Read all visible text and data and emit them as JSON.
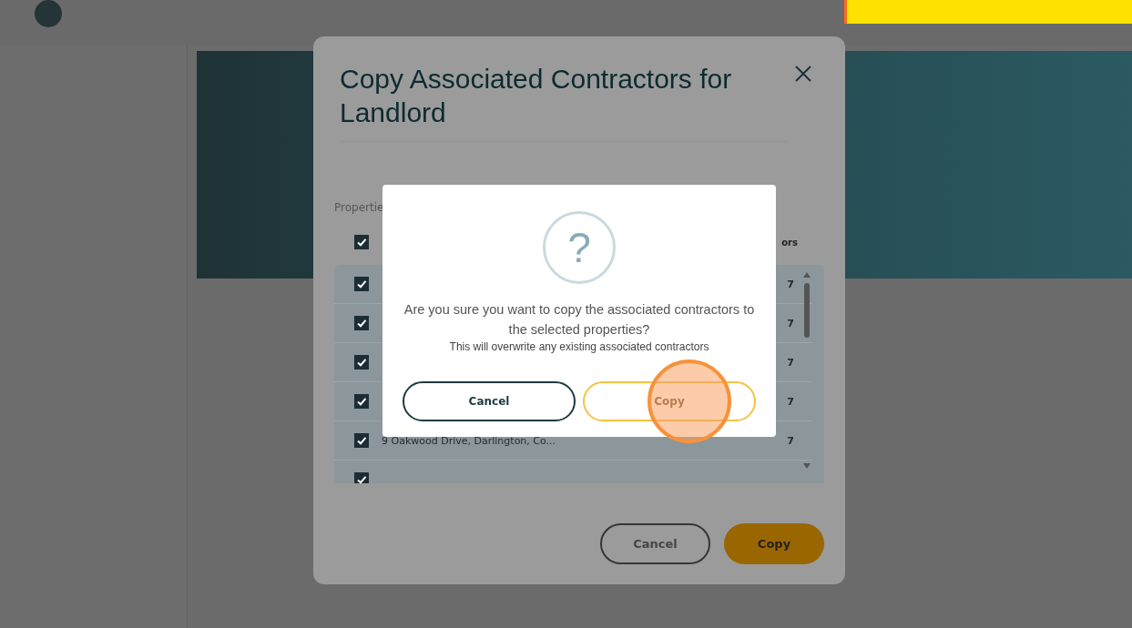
{
  "modal": {
    "title": "Copy Associated Contractors for Landlord",
    "table_label": "Propertie",
    "select_all": {
      "checked": true
    },
    "columns": [
      {
        "label": "ors"
      }
    ],
    "rows": [
      {
        "checked": true,
        "count": "7"
      },
      {
        "checked": true,
        "count": "7"
      },
      {
        "checked": true,
        "count": "7"
      },
      {
        "checked": true,
        "count": "7"
      },
      {
        "checked": true,
        "address": "9 Oakwood Drive, Darlington, Co...",
        "count": "7"
      },
      {
        "checked": true
      }
    ],
    "buttons": [
      {
        "label": "Cancel",
        "kind": "secondary"
      },
      {
        "label": "Copy",
        "kind": "primary"
      }
    ]
  },
  "confirm": {
    "icon": "?",
    "question": "Are you sure you want to copy the associated contractors to the selected properties?",
    "note": "This will overwrite any existing associated contractors",
    "buttons": [
      {
        "label": "Cancel",
        "kind": "secondary",
        "clicked": false
      },
      {
        "label": "Copy",
        "kind": "primary",
        "clicked": true
      }
    ]
  }
}
